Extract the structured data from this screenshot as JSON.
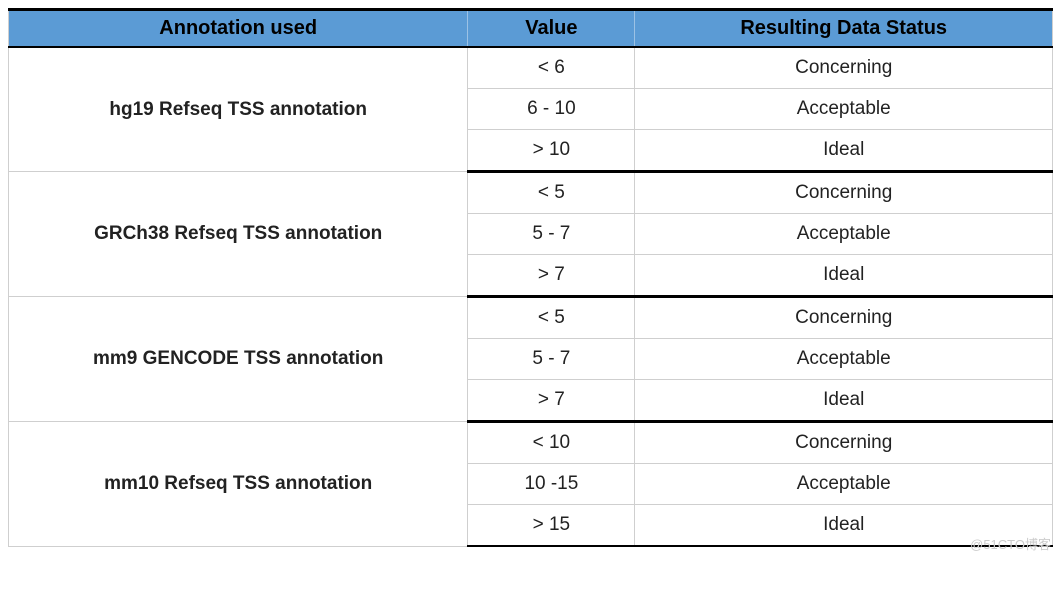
{
  "headers": {
    "annotation": "Annotation used",
    "value": "Value",
    "status": "Resulting Data Status"
  },
  "groups": [
    {
      "annotation": "hg19 Refseq TSS annotation",
      "rows": [
        {
          "value": "< 6",
          "status": "Concerning"
        },
        {
          "value": "6 - 10",
          "status": "Acceptable"
        },
        {
          "value": "> 10",
          "status": "Ideal"
        }
      ]
    },
    {
      "annotation": "GRCh38 Refseq TSS annotation",
      "rows": [
        {
          "value": "< 5",
          "status": "Concerning"
        },
        {
          "value": "5 - 7",
          "status": "Acceptable"
        },
        {
          "value": "> 7",
          "status": "Ideal"
        }
      ]
    },
    {
      "annotation": "mm9 GENCODE TSS annotation",
      "rows": [
        {
          "value": "< 5",
          "status": "Concerning"
        },
        {
          "value": "5 - 7",
          "status": "Acceptable"
        },
        {
          "value": "> 7",
          "status": "Ideal"
        }
      ]
    },
    {
      "annotation": "mm10 Refseq TSS annotation",
      "rows": [
        {
          "value": "< 10",
          "status": "Concerning"
        },
        {
          "value": "10 -15",
          "status": "Acceptable"
        },
        {
          "value": "> 15",
          "status": "Ideal"
        }
      ]
    }
  ],
  "watermark": "@51CTO博客"
}
